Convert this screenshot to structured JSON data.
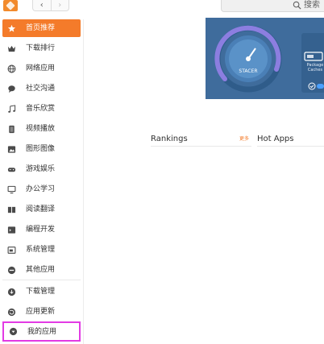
{
  "toolbar": {
    "back_glyph": "‹",
    "forward_glyph": "›",
    "search_placeholder": "搜索",
    "logo_icon": "app-store-logo",
    "search_icon": "magnifier-icon"
  },
  "sidebar": {
    "items": [
      {
        "label": "首页推荐",
        "icon": "star-icon",
        "active": true
      },
      {
        "label": "下载排行",
        "icon": "crown-icon"
      },
      {
        "label": "网络应用",
        "icon": "globe-icon"
      },
      {
        "label": "社交沟通",
        "icon": "chat-bubble-icon"
      },
      {
        "label": "音乐欣赏",
        "icon": "music-note-icon"
      },
      {
        "label": "视频播放",
        "icon": "film-icon"
      },
      {
        "label": "图形图像",
        "icon": "picture-icon"
      },
      {
        "label": "游戏娱乐",
        "icon": "gamepad-icon"
      },
      {
        "label": "办公学习",
        "icon": "monitor-icon"
      },
      {
        "label": "阅读翻译",
        "icon": "book-icon"
      },
      {
        "label": "编程开发",
        "icon": "code-icon"
      },
      {
        "label": "系统管理",
        "icon": "terminal-icon"
      },
      {
        "label": "其他应用",
        "icon": "more-icon"
      }
    ],
    "bottom_items": [
      {
        "label": "下载管理",
        "icon": "download-icon"
      },
      {
        "label": "应用更新",
        "icon": "update-icon"
      },
      {
        "label": "我的应用",
        "icon": "my-apps-icon",
        "highlighted": true
      }
    ]
  },
  "banner": {
    "dial_text": "STACER",
    "card_label": "Package Caches"
  },
  "sections": {
    "rankings_title": "Rankings",
    "more_label": "更多",
    "hot_apps_title": "Hot Apps"
  },
  "colors": {
    "accent": "#f47b2a",
    "banner_bg": "#3f6c9c",
    "highlight_outline": "#e23be4",
    "icon_gray": "#4a4a4a"
  }
}
